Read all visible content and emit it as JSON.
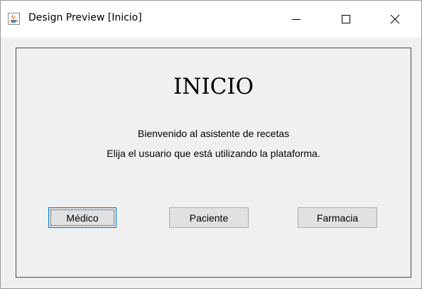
{
  "window": {
    "title": "Design Preview [Inicio]",
    "icon": "java-cup-icon",
    "controls": {
      "minimize": "minimize-icon",
      "maximize": "maximize-icon",
      "close": "close-icon"
    }
  },
  "panel": {
    "heading": "INICIO",
    "welcome": "Bienvenido al asistente de recetas",
    "instruction": "Elija el usuario que está utilizando la plataforma."
  },
  "buttons": {
    "medico": "Médico",
    "paciente": "Paciente",
    "farmacia": "Farmacia"
  },
  "colors": {
    "focus_border": "#0078d7",
    "background": "#f0f0f0"
  }
}
